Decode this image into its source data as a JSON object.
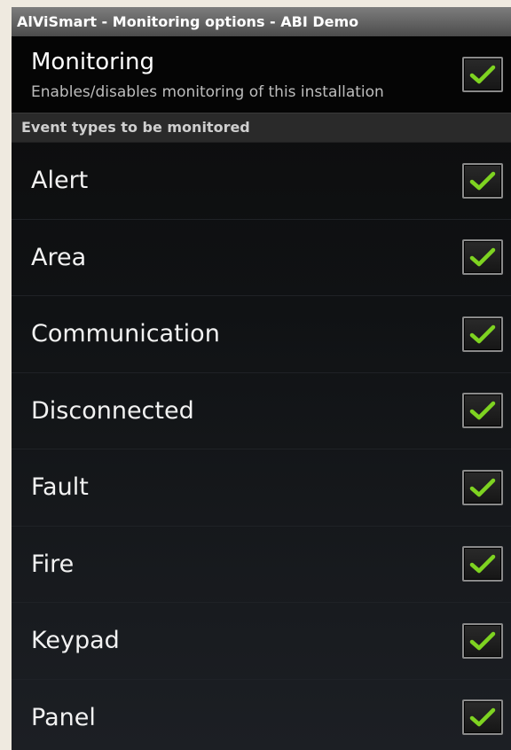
{
  "window": {
    "title": "AlViSmart - Monitoring options - ABI Demo"
  },
  "monitoring": {
    "title": "Monitoring",
    "summary": "Enables/disables monitoring of this installation",
    "checked": true
  },
  "section": {
    "header": "Event types to be monitored"
  },
  "event_types": [
    {
      "label": "Alert",
      "checked": true
    },
    {
      "label": "Area",
      "checked": true
    },
    {
      "label": "Communication",
      "checked": true
    },
    {
      "label": "Disconnected",
      "checked": true
    },
    {
      "label": "Fault",
      "checked": true
    },
    {
      "label": "Fire",
      "checked": true
    },
    {
      "label": "Keypad",
      "checked": true
    },
    {
      "label": "Panel",
      "checked": true
    }
  ],
  "colors": {
    "check": "#7ed321",
    "background": "#0b0b0b",
    "titlebar": "#5e5e5e"
  },
  "icons": {
    "checkbox": "checkmark-icon"
  }
}
